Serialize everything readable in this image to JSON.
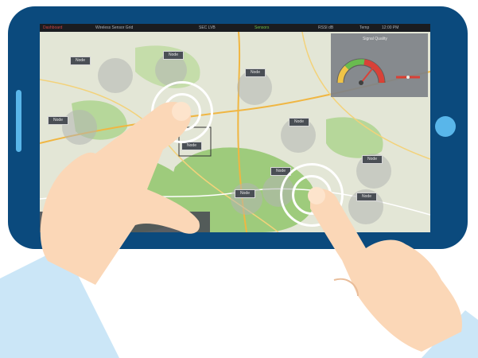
{
  "topbar": {
    "items": [
      "Dashboard",
      "Wireless Sensor Grid",
      "SEC LVB",
      "Sensors",
      "RSSI dB",
      "Temp",
      "12:00 PM"
    ]
  },
  "map": {
    "markers": [
      "Node",
      "Node",
      "Node",
      "Node",
      "Node",
      "Node",
      "Node",
      "Node",
      "Node",
      "Node"
    ]
  },
  "gauge": {
    "title": "Signal Quality"
  },
  "colors": {
    "tablet": "#0b4a7d",
    "accent": "#59b6ea",
    "forest": "#9ecb7c",
    "road": "#f0b642",
    "gauge_red": "#d9342b",
    "gauge_green": "#5fb844",
    "skin": "#fbd7b7",
    "sleeve": "#cbe6f7"
  }
}
